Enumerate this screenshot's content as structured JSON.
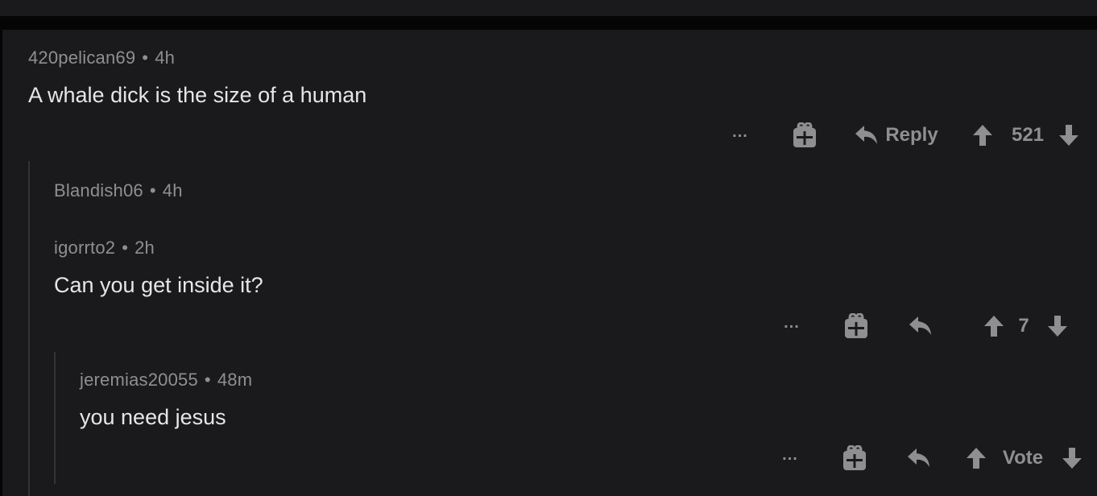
{
  "comments": [
    {
      "author": "420pelican69",
      "separator": "•",
      "age": "4h",
      "body": "A whale dick  is the size of a human",
      "reply_label": "Reply",
      "vote_label": "521",
      "more_label": "..."
    },
    {
      "author": "Blandish06",
      "separator": "•",
      "age": "4h"
    },
    {
      "author": "igorrto2",
      "separator": "•",
      "age": "2h",
      "body": "Can you get inside it?",
      "vote_label": "7",
      "more_label": "..."
    },
    {
      "author": "jeremias20055",
      "separator": "•",
      "age": "48m",
      "body": "you need jesus",
      "vote_label": "Vote",
      "more_label": "..."
    }
  ],
  "icons": {
    "more": "more-options-icon",
    "award": "gift-award-icon",
    "reply": "reply-arrow-icon",
    "upvote": "upvote-arrow-icon",
    "downvote": "downvote-arrow-icon"
  },
  "colors": {
    "background": "#050505",
    "card": "#1a1a1c",
    "meta_text": "#8f8f92",
    "body_text": "#e6e6e8",
    "thread_line": "#333336"
  }
}
